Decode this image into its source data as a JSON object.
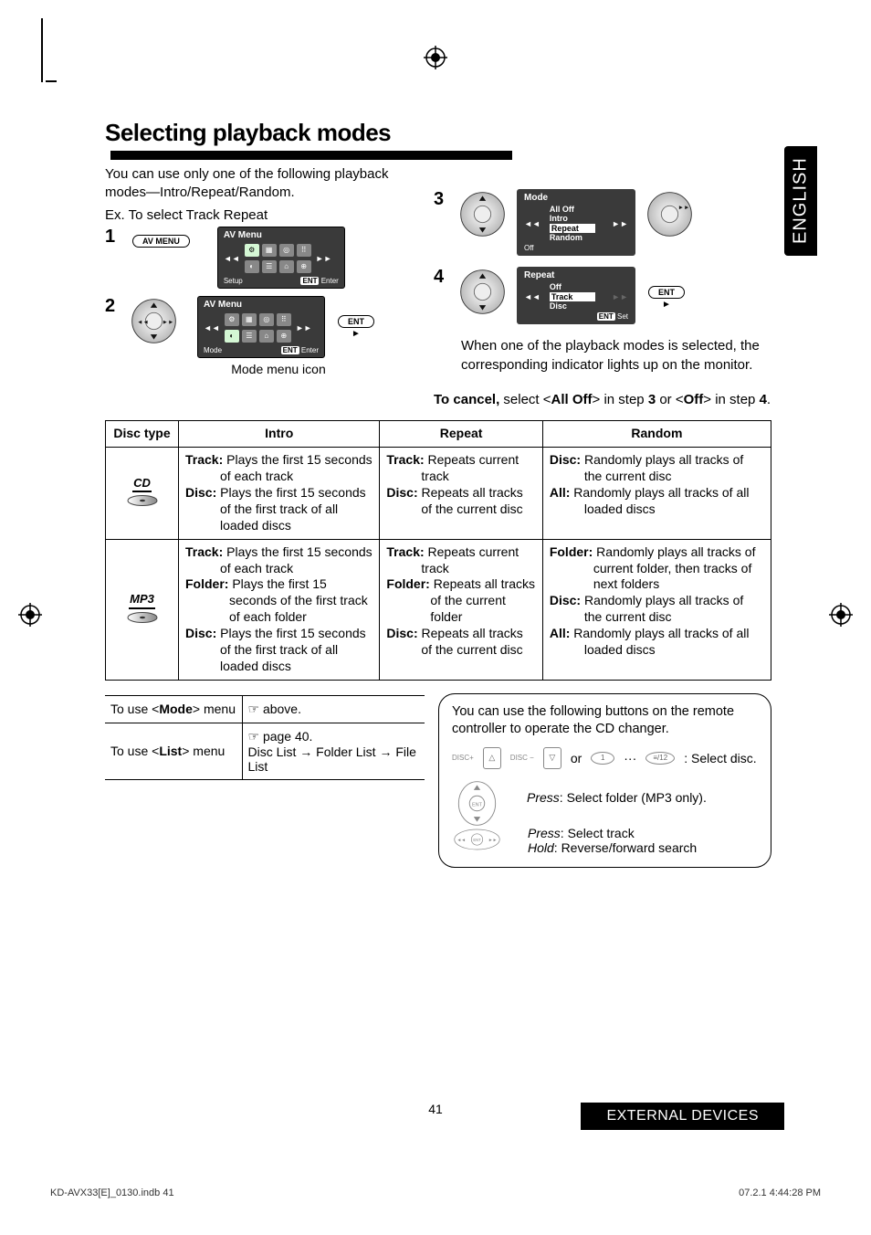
{
  "sideTab": "ENGLISH",
  "heading": "Selecting playback modes",
  "introLines": [
    "You can use only one of the following playback modes—Intro/Repeat/Random.",
    "Ex. To select Track Repeat"
  ],
  "steps": {
    "s1": "1",
    "s2": "2",
    "s3": "3",
    "s4": "4"
  },
  "avMenuBtn": "AV MENU",
  "entBtn": "ENT",
  "modeMenuIconCaption": "Mode menu icon",
  "avMenu": {
    "title": "AV Menu",
    "footerLeftSetup": "Setup",
    "footerLeftMode": "Mode",
    "footerRight": "Enter",
    "footerEnt": "ENT"
  },
  "screen3": {
    "title": "Mode",
    "items": [
      "All Off",
      "Intro",
      "Repeat",
      "Random"
    ],
    "footer": "Off"
  },
  "screen4": {
    "title": "Repeat",
    "items": [
      "Off",
      "Track",
      "Disc"
    ],
    "footerEnt": "ENT",
    "footerLabel": "Set"
  },
  "para3": "When one of the playback modes is selected, the corresponding indicator lights up on the monitor.",
  "cancel": {
    "prefix": "To cancel,",
    "mid1": " select <",
    "allOff": "All Off",
    "mid2": "> in step ",
    "step3": "3",
    "mid3": " or <",
    "off": "Off",
    "mid4": "> in step ",
    "step4": "4",
    "end": "."
  },
  "table": {
    "headers": [
      "Disc type",
      "Intro",
      "Repeat",
      "Random"
    ],
    "row1": {
      "discLabel": "CD",
      "intro": {
        "l1b": "Track:",
        "l1": " Plays the first 15 seconds of each track",
        "l2b": "Disc:",
        "l2": " Plays the first 15 seconds of the first track of all loaded discs"
      },
      "repeat": {
        "l1b": "Track:",
        "l1": " Repeats current track",
        "l2b": "Disc:",
        "l2": " Repeats all tracks of the current disc"
      },
      "random": {
        "l1b": "Disc:",
        "l1": " Randomly plays all tracks of the current disc",
        "l2b": "All:",
        "l2": " Randomly plays all tracks of all loaded discs"
      }
    },
    "row2": {
      "discLabel": "MP3",
      "intro": {
        "l1b": "Track:",
        "l1": " Plays the first 15 seconds of each track",
        "l2b": "Folder:",
        "l2": " Plays the first 15 seconds of the first track of each folder",
        "l3b": "Disc:",
        "l3": " Plays the first 15 seconds of the first track of all loaded discs"
      },
      "repeat": {
        "l1b": "Track:",
        "l1": " Repeats current track",
        "l2b": "Folder:",
        "l2": " Repeats all tracks of the current folder",
        "l3b": "Disc:",
        "l3": " Repeats all tracks of the current disc"
      },
      "random": {
        "l1b": "Folder:",
        "l1": " Randomly plays all tracks of current folder, then tracks of next folders",
        "l2b": "Disc:",
        "l2": " Randomly plays all tracks of the current disc",
        "l3b": "All:",
        "l3": " Randomly plays all tracks of all loaded discs"
      }
    }
  },
  "menuTable": {
    "r1a": "To use <",
    "r1b": "Mode",
    "r1c": "> menu",
    "r1val": "☞ above.",
    "r2a": "To use <",
    "r2b": "List",
    "r2c": "> menu",
    "r2l1": "☞ page 40.",
    "r2l2a": "Disc List ",
    "r2l2b": " Folder List ",
    "r2l2c": " File List"
  },
  "remote": {
    "intro": "You can use the following buttons on the remote controller to operate the CD changer.",
    "discPlus": "DISC+",
    "discMinus": "DISC −",
    "or": "or",
    "dots": "···",
    "selectDisc": " : Select disc.",
    "pressLabel": "Press",
    "folder": ":  Select folder (MP3 only).",
    "track": ":  Select track",
    "holdLabel": "Hold",
    "search": ":   Reverse/forward search"
  },
  "pageNumber": "41",
  "footerTab": "EXTERNAL DEVICES",
  "footerLeft": "KD-AVX33[E]_0130.indb   41",
  "footerRight": "07.2.1   4:44:28 PM"
}
